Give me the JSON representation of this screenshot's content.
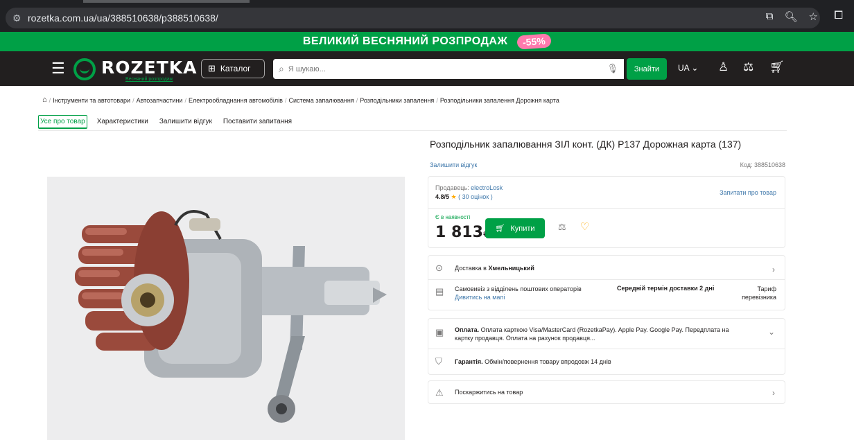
{
  "browser": {
    "url": "rozetka.com.ua/ua/388510638/p388510638/"
  },
  "promo": {
    "text": "ВЕЛИКИЙ ВЕСНЯНИЙ РОЗПРОДАЖ",
    "badge": "-55%"
  },
  "header": {
    "logo": "ROZETKA",
    "logo_sub": "Весняний розпродаж",
    "catalog_label": "Каталог",
    "search_placeholder": "Я шукаю...",
    "search_button": "Знайти",
    "lang": "UA",
    "colors": {
      "bg": "#221f1f",
      "accent": "#00a046"
    }
  },
  "breadcrumbs": [
    "Інструменти та автотовари",
    "Автозапчастини",
    "Електрообладнання автомобілів",
    "Система запалювання",
    "Розподільники запалення",
    "Розподільники запалення Дорожня карта"
  ],
  "tabs": [
    {
      "label": "Усе про товар",
      "active": true
    },
    {
      "label": "Характеристики",
      "active": false
    },
    {
      "label": "Залишити відгук",
      "active": false
    },
    {
      "label": "Поставити запитання",
      "active": false
    }
  ],
  "product": {
    "title": "Розподільник запалювання ЗІЛ конт. (ДК) Р137 Дорожная карта (137)",
    "write_review": "Залишити відгук",
    "code": "Код: 388510638",
    "seller_label": "Продавець:",
    "seller_name": "electroLosk",
    "rating_value": "4.8/5",
    "rating_count": "( 30 оцінок )",
    "ask_seller": "Запитати про товар",
    "stock": "Є в наявності",
    "price": "1 813",
    "currency": "₴",
    "buy_label": "Купити"
  },
  "delivery": {
    "label_prefix": "Доставка в ",
    "city": "Хмельницький",
    "pickup_title": "Самовивіз з відділень поштових операторів",
    "pickup_link": "Дивитись на мапі",
    "term": "Середній термін доставки 2 дні",
    "tariff_line1": "Тариф",
    "tariff_line2": "перевізника"
  },
  "payment": {
    "label": "Оплата.",
    "text": "Оплата карткою Visa/MasterCard (RozetkaPay). Apple Pay. Google Pay. Передплата на картку продавця. Оплата на рахунок продавця..."
  },
  "warranty": {
    "label": "Гарантія.",
    "text": "Обмін/повернення товару впродовж 14 днів"
  },
  "complain": {
    "text": "Поскаржитись на товар"
  }
}
